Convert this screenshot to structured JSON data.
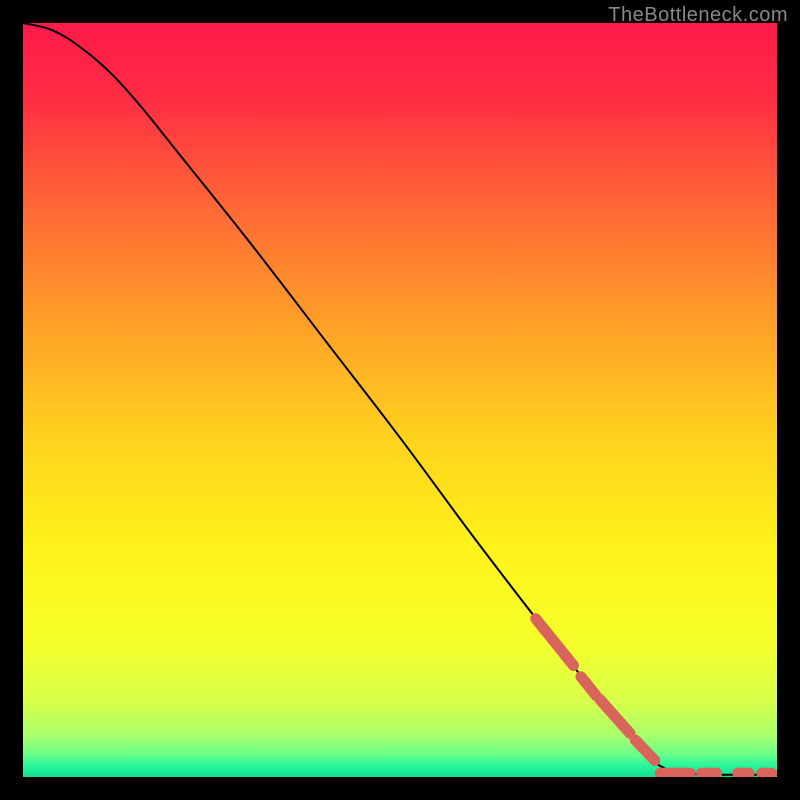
{
  "attribution": "TheBottleneck.com",
  "chart_data": {
    "type": "line",
    "title": "",
    "xlabel": "",
    "ylabel": "",
    "xlim": [
      0,
      100
    ],
    "ylim": [
      0,
      100
    ],
    "grid": false,
    "curve": [
      {
        "x": 0,
        "y": 100
      },
      {
        "x": 4,
        "y": 99
      },
      {
        "x": 8,
        "y": 96.5
      },
      {
        "x": 12,
        "y": 93
      },
      {
        "x": 16,
        "y": 88.5
      },
      {
        "x": 20,
        "y": 83.5
      },
      {
        "x": 30,
        "y": 71
      },
      {
        "x": 40,
        "y": 58
      },
      {
        "x": 50,
        "y": 45
      },
      {
        "x": 60,
        "y": 31.5
      },
      {
        "x": 70,
        "y": 18.5
      },
      {
        "x": 78,
        "y": 8.5
      },
      {
        "x": 83,
        "y": 2.8
      },
      {
        "x": 85,
        "y": 1.2
      },
      {
        "x": 87,
        "y": 0.6
      },
      {
        "x": 90,
        "y": 0.35
      },
      {
        "x": 95,
        "y": 0.3
      },
      {
        "x": 100,
        "y": 0.3
      }
    ],
    "highlight_segments": [
      {
        "x0": 68,
        "y0": 21.0,
        "x1": 73,
        "y1": 14.8
      },
      {
        "x0": 74,
        "y0": 13.3,
        "x1": 76,
        "y1": 10.8
      },
      {
        "x0": 76.5,
        "y0": 10.3,
        "x1": 80.5,
        "y1": 5.8
      },
      {
        "x0": 81.2,
        "y0": 4.9,
        "x1": 83.8,
        "y1": 2.2
      }
    ],
    "highlight_flat": [
      {
        "x0": 84.5,
        "x1": 88.5
      },
      {
        "x0": 90,
        "x1": 92
      },
      {
        "x0": 94.8,
        "x1": 96.3
      },
      {
        "x0": 98,
        "x1": 99.3
      }
    ],
    "flat_y": 0.5,
    "gradient_stops": [
      {
        "offset": 0.0,
        "color": "#ff1a4a"
      },
      {
        "offset": 0.1,
        "color": "#ff2d44"
      },
      {
        "offset": 0.25,
        "color": "#ff6a35"
      },
      {
        "offset": 0.4,
        "color": "#ffa028"
      },
      {
        "offset": 0.55,
        "color": "#ffd21e"
      },
      {
        "offset": 0.7,
        "color": "#fff31a"
      },
      {
        "offset": 0.82,
        "color": "#f5ff2a"
      },
      {
        "offset": 0.9,
        "color": "#d8ff4a"
      },
      {
        "offset": 0.945,
        "color": "#a8ff6a"
      },
      {
        "offset": 0.97,
        "color": "#6aff8a"
      },
      {
        "offset": 0.985,
        "color": "#28f59a"
      },
      {
        "offset": 1.0,
        "color": "#10e090"
      }
    ],
    "highlight_color": "#d9645b",
    "curve_color": "#000000"
  }
}
